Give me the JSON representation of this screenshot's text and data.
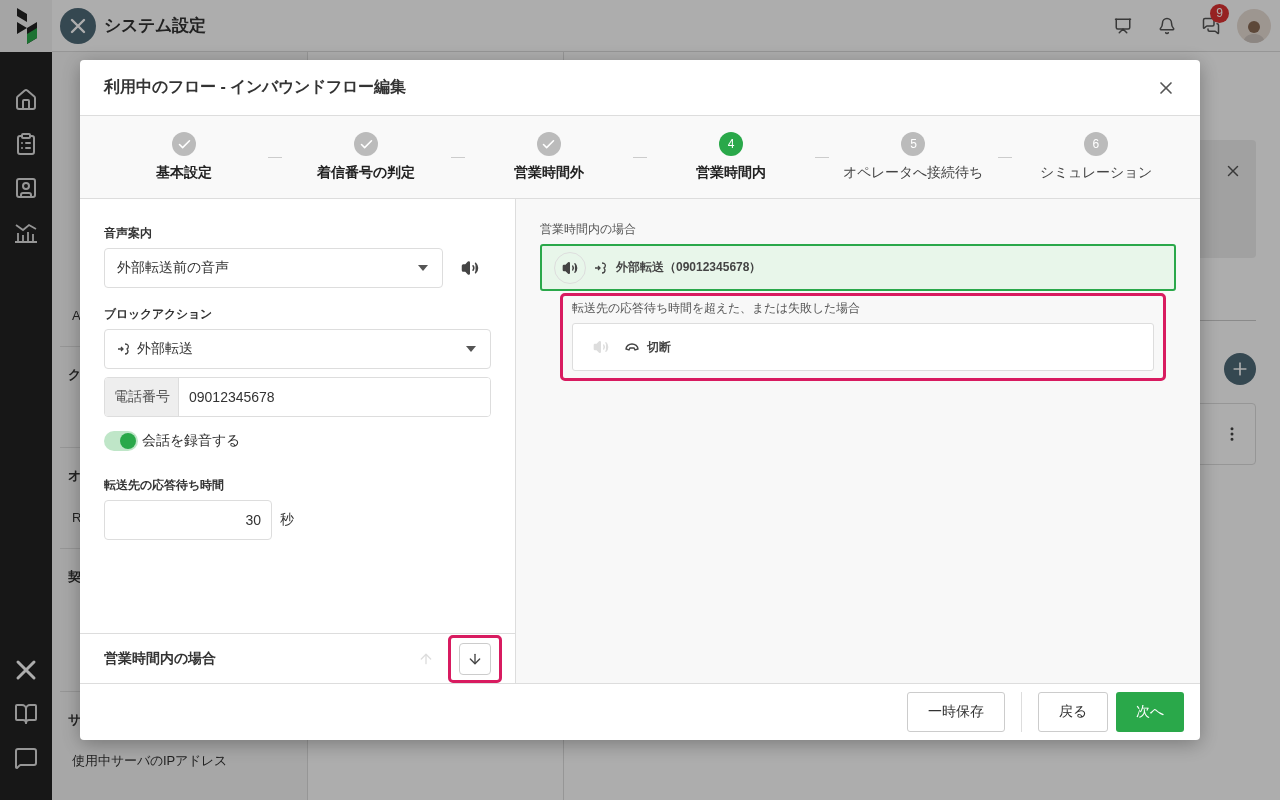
{
  "header": {
    "title": "システム設定",
    "notification_badge": "9"
  },
  "sidebar": {
    "sections": [
      {
        "items": [
          {
            "label": "A"
          }
        ]
      },
      {
        "heading": "ク"
      },
      {
        "heading": "オ",
        "items": [
          {
            "label": "R"
          }
        ]
      },
      {
        "heading": "契"
      },
      {
        "heading": "サ",
        "items": [
          {
            "label": "使用中サーバのIPアドレス"
          }
        ]
      }
    ]
  },
  "dialog": {
    "title": "利用中のフロー - インバウンドフロー編集",
    "steps": [
      {
        "label": "基本設定",
        "done": true,
        "current": false
      },
      {
        "label": "着信番号の判定",
        "done": true,
        "current": false
      },
      {
        "label": "営業時間外",
        "done": true,
        "current": false
      },
      {
        "label": "営業時間内",
        "done": false,
        "current": true,
        "number": "4"
      },
      {
        "label": "オペレータへ接続待ち",
        "done": false,
        "current": false,
        "number": "5"
      },
      {
        "label": "シミュレーション",
        "done": false,
        "current": false,
        "number": "6"
      }
    ],
    "form": {
      "voice_label": "音声案内",
      "voice_value": "外部転送前の音声",
      "action_label": "ブロックアクション",
      "action_value": "外部転送",
      "phone_addon": "電話番号",
      "phone_value": "09012345678",
      "record": {
        "label": "会話を録音する",
        "on": true
      },
      "wait_label": "転送先の応答待ち時間",
      "wait_value": "30",
      "wait_unit": "秒"
    },
    "section_bar": {
      "title": "営業時間内の場合",
      "up_disabled": true,
      "down_disabled": false
    },
    "flow": {
      "label": "営業時間内の場合",
      "node": {
        "text": "外部転送（09012345678）",
        "selected": true,
        "audio": true
      },
      "branch": {
        "label": "転送先の応答待ち時間を超えた、または失敗した場合",
        "node": {
          "text": "切断",
          "selected": false,
          "audio": false
        }
      }
    },
    "buttons": {
      "save": "一時保存",
      "back": "戻る",
      "next": "次へ"
    }
  }
}
